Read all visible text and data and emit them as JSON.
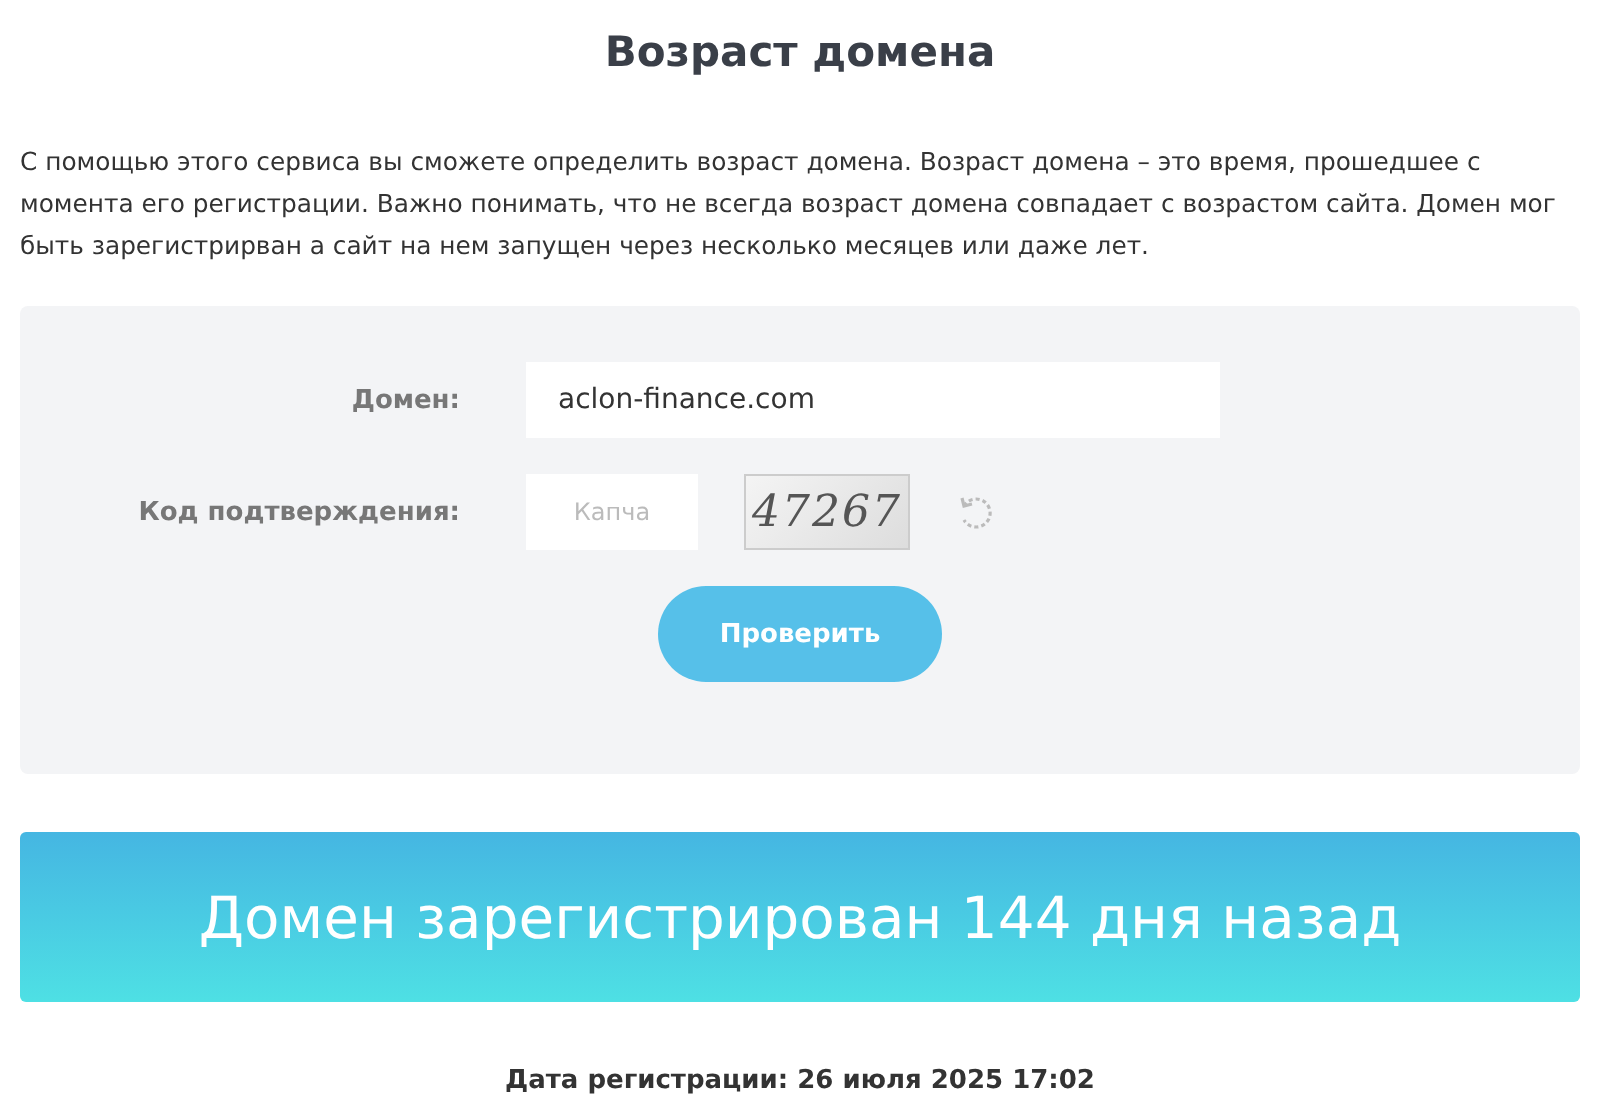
{
  "title": "Возраст домена",
  "description": "С помощью этого сервиса вы сможете определить возраст домена. Возраст домена – это время, прошедшее с момента его регистрации. Важно понимать, что не всегда возраст домена совпадает с возрастом сайта. Домен мог быть зарегистрирван а сайт на нем запущен через несколько месяцев или даже лет.",
  "form": {
    "domain_label": "Домен:",
    "domain_value": "aclon-finance.com",
    "captcha_label": "Код подтверждения:",
    "captcha_placeholder": "Капча",
    "captcha_image": "47267",
    "submit": "Проверить"
  },
  "result": "Домен зарегистрирован 144 дня назад",
  "registration_date": "Дата регистрации: 26 июля 2025 17:02"
}
